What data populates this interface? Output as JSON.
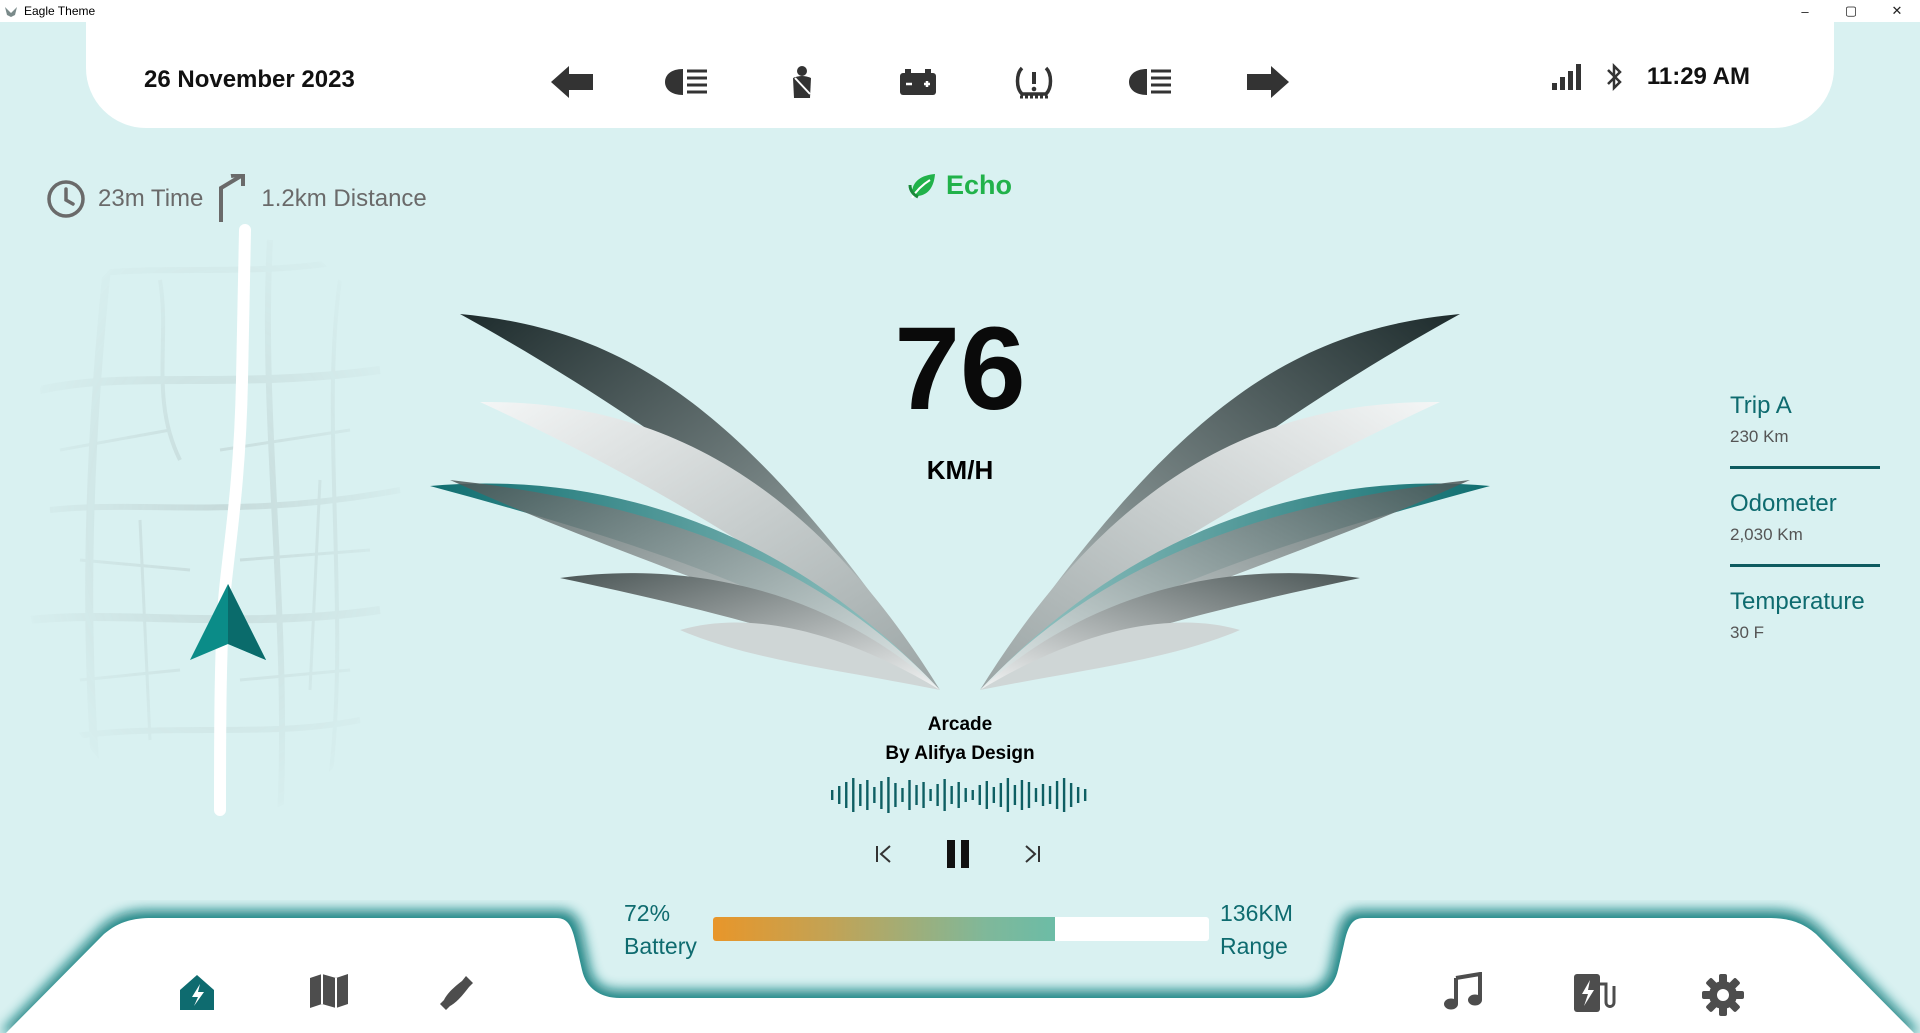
{
  "window": {
    "title": "Eagle Theme",
    "controls": [
      "–",
      "▢",
      "✕"
    ]
  },
  "header": {
    "date": "26 November 2023",
    "indicators": [
      "turn-left-arrow",
      "low-beam-headlight",
      "seatbelt",
      "battery-warning",
      "tire-pressure-warning",
      "high-beam-headlight",
      "turn-right-arrow"
    ],
    "time": "11:29 AM"
  },
  "navigation": {
    "time": "23m Time",
    "distance": "1.2km Distance"
  },
  "mode": {
    "label": "Echo"
  },
  "speed": {
    "value": "76",
    "unit": "KM/H"
  },
  "music": {
    "title": "Arcade",
    "artist": "By Alifya Design"
  },
  "trip": {
    "items": [
      {
        "label": "Trip A",
        "value": "230 Km"
      },
      {
        "label": "Odometer",
        "value": "2,030 Km"
      },
      {
        "label": "Temperature",
        "value": "30 F"
      }
    ]
  },
  "battery": {
    "percent": "72%",
    "label": "Battery",
    "level": 0.69
  },
  "range": {
    "value": "136KM",
    "label": "Range"
  },
  "dock": {
    "left": [
      "home-icon",
      "map-icon",
      "phone-icon"
    ],
    "right": [
      "music-icon",
      "charging-icon",
      "settings-icon"
    ]
  },
  "colors": {
    "accent": "#0e6b6f",
    "eco": "#21b24a",
    "background": "#d9f1f1"
  }
}
